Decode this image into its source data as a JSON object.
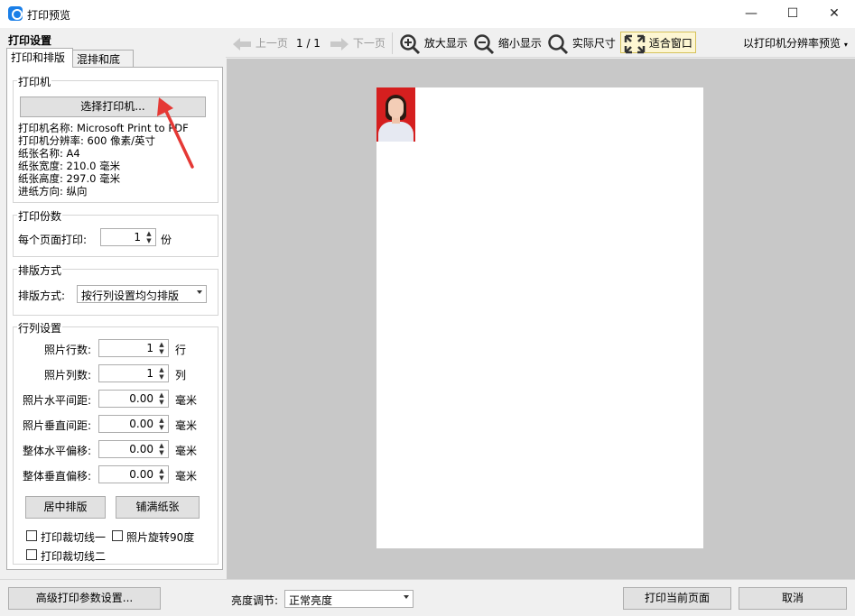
{
  "window": {
    "title": "打印预览",
    "min_glyph": "—",
    "max_glyph": "☐",
    "close_glyph": "✕"
  },
  "left_panel": {
    "title": "打印设置",
    "tabs": [
      {
        "label": "打印和排版",
        "active": true
      },
      {
        "label": "混排和底版",
        "active": false
      }
    ],
    "printer_group": {
      "title": "打印机",
      "select_button": "选择打印机...",
      "info": [
        "打印机名称: Microsoft Print to PDF",
        "打印机分辨率: 600 像素/英寸",
        "纸张名称: A4",
        "纸张宽度: 210.0 毫米",
        "纸张高度: 297.0 毫米",
        "进纸方向: 纵向"
      ]
    },
    "copies_group": {
      "title": "打印份数",
      "label": "每个页面打印:",
      "value": "1",
      "unit": "份"
    },
    "layout_group": {
      "title": "排版方式",
      "label": "排版方式:",
      "value": "按行列设置均匀排版"
    },
    "grid_group": {
      "title": "行列设置",
      "rows": [
        {
          "label": "照片行数:",
          "value": "1",
          "unit": "行"
        },
        {
          "label": "照片列数:",
          "value": "1",
          "unit": "列"
        },
        {
          "label": "照片水平间距:",
          "value": "0.00",
          "unit": "毫米"
        },
        {
          "label": "照片垂直间距:",
          "value": "0.00",
          "unit": "毫米"
        },
        {
          "label": "整体水平偏移:",
          "value": "0.00",
          "unit": "毫米"
        },
        {
          "label": "整体垂直偏移:",
          "value": "0.00",
          "unit": "毫米"
        }
      ],
      "center_button": "居中排版",
      "fill_button": "铺满纸张",
      "checkboxes": [
        {
          "label": "打印裁切线一",
          "checked": false
        },
        {
          "label": "照片旋转90度",
          "checked": false
        },
        {
          "label": "打印裁切线二",
          "checked": false
        }
      ]
    }
  },
  "toolbar": {
    "prev_page": "上一页",
    "page_indicator": "1 / 1",
    "next_page": "下一页",
    "zoom_in": "放大显示",
    "zoom_out": "缩小显示",
    "actual_size": "实际尺寸",
    "fit_window": "适合窗口",
    "preview_mode": "以打印机分辨率预览"
  },
  "bottom": {
    "advanced_button": "高级打印参数设置...",
    "brightness_label": "亮度调节:",
    "brightness_value": "正常亮度",
    "print_button": "打印当前页面",
    "cancel_button": "取消"
  },
  "colors": {
    "accent": "#1a7fe8",
    "annotation_arrow": "#e53935",
    "photo_background": "#d51f1f",
    "preview_background": "#c8c8c8"
  }
}
